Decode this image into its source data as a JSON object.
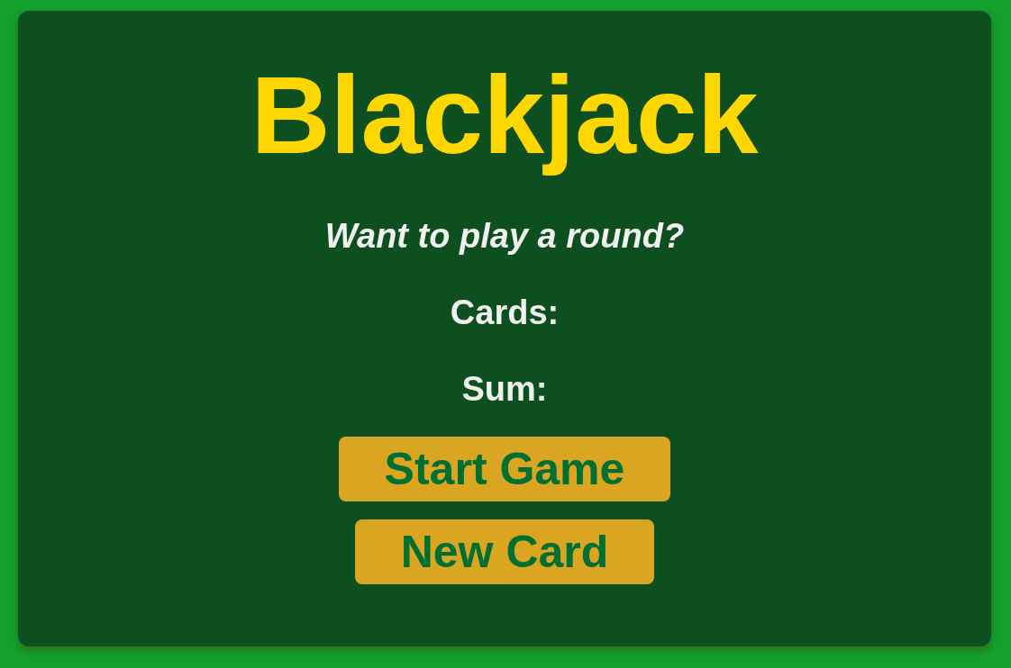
{
  "title": "Blackjack",
  "message": "Want to play a round?",
  "cards_label": "Cards:",
  "sum_label": "Sum:",
  "buttons": [
    "Start Game",
    "New Card"
  ]
}
